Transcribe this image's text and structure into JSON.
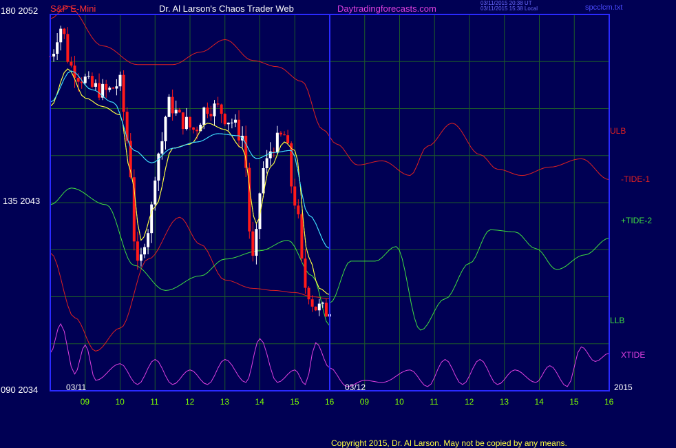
{
  "header": {
    "symbol": "S&P E-Mini",
    "title": "Dr. Al Larson's Chaos Trader Web",
    "site": "Daytradingforecasts.com",
    "timestamp_utc": "03/11/2015 20:38 UT",
    "timestamp_local": "03/11/2015 15:38 Local",
    "file": "spcclcm.txt"
  },
  "y_axis": {
    "top_label": "180  2052",
    "mid_label": "135  2043",
    "bottom_label": "090  2034"
  },
  "dates": {
    "left": "03/11",
    "right": "03/12",
    "year": "2015"
  },
  "footer": {
    "copyright": "Copyright 2015, Dr. Al Larson. May not be copied by any means."
  },
  "colors": {
    "background": "#000054",
    "frame": "#2a2aff",
    "grid": "#1c5a2a",
    "ulb": "#e02020",
    "llb": "#40e040",
    "tide1": "#e02020",
    "tide2": "#40e040",
    "xtide": "#e040e0",
    "candle_up": "#ffffff",
    "candle_down": "#ff1a1a",
    "ma_fast": "#ffff40",
    "ma_slow": "#40e0ff",
    "hour_label": "#7cfc00"
  },
  "chart_data": {
    "type": "line",
    "title": "S&P E-Mini",
    "x_tick_labels": [
      "09",
      "10",
      "11",
      "12",
      "13",
      "14",
      "15",
      "16",
      "09",
      "10",
      "11",
      "12",
      "13",
      "14",
      "15",
      "16"
    ],
    "y_axis_price": {
      "min": 2034,
      "max": 2052,
      "labels": [
        2034,
        2043,
        2052
      ]
    },
    "y_axis_cycle": {
      "min": 90,
      "max": 180,
      "labels": [
        90,
        135,
        180
      ]
    },
    "hours": {
      "start": 8.0,
      "sessions": 2,
      "session_end": 16.0
    },
    "series": [
      {
        "name": "ULB",
        "points": [
          [
            8.0,
            2051.8
          ],
          [
            8.5,
            2052.4
          ],
          [
            9.5,
            2050.5
          ],
          [
            10.5,
            2049.6
          ],
          [
            11.5,
            2049.6
          ],
          [
            12.3,
            2050.2
          ],
          [
            13.0,
            2050.8
          ],
          [
            13.8,
            2049.8
          ],
          [
            14.5,
            2049.5
          ],
          [
            15.2,
            2048.8
          ],
          [
            15.8,
            2046.5
          ],
          [
            16.2,
            2045.8
          ],
          [
            16.8,
            2044.8
          ],
          [
            17.5,
            2045.0
          ],
          [
            18.3,
            2044.3
          ],
          [
            18.8,
            2045.7
          ],
          [
            19.5,
            2046.8
          ],
          [
            20.3,
            2045.3
          ],
          [
            20.8,
            2044.6
          ],
          [
            21.5,
            2044.3
          ],
          [
            22.3,
            2044.7
          ],
          [
            23.2,
            2045.1
          ],
          [
            24.0,
            2044.1
          ]
        ]
      },
      {
        "name": "-TIDE-1",
        "points": [
          [
            8.0,
            2040.6
          ],
          [
            8.7,
            2037.5
          ],
          [
            9.3,
            2035.9
          ],
          [
            10.0,
            2037.0
          ],
          [
            10.8,
            2040.3
          ],
          [
            11.7,
            2042.3
          ],
          [
            12.3,
            2041.0
          ],
          [
            13.0,
            2039.3
          ],
          [
            13.8,
            2038.9
          ],
          [
            14.4,
            2038.8
          ],
          [
            15.0,
            2038.7
          ],
          [
            15.5,
            2038.5
          ],
          [
            16.0,
            2038.4
          ]
        ]
      },
      {
        "name": "+TIDE-2",
        "points": [
          [
            16.0,
            2038.2
          ],
          [
            16.6,
            2040.2
          ],
          [
            17.3,
            2040.2
          ],
          [
            17.9,
            2040.9
          ],
          [
            18.6,
            2036.9
          ],
          [
            19.3,
            2038.4
          ],
          [
            20.0,
            2040.1
          ],
          [
            20.6,
            2041.7
          ],
          [
            21.3,
            2041.6
          ],
          [
            21.9,
            2040.8
          ],
          [
            22.5,
            2039.8
          ],
          [
            23.3,
            2040.5
          ],
          [
            24.0,
            2041.3
          ]
        ]
      },
      {
        "name": "LLB",
        "points": [
          [
            8.0,
            2042.9
          ],
          [
            8.6,
            2043.7
          ],
          [
            9.6,
            2042.9
          ],
          [
            10.4,
            2040.0
          ],
          [
            11.3,
            2038.8
          ],
          [
            12.3,
            2039.5
          ],
          [
            13.0,
            2040.3
          ],
          [
            14.0,
            2040.7
          ],
          [
            14.8,
            2041.2
          ],
          [
            15.5,
            2039.5
          ],
          [
            16.0,
            2037.1
          ]
        ]
      },
      {
        "name": "XTIDE",
        "points": [
          [
            8.0,
            2035.8
          ],
          [
            8.3,
            2037.2
          ],
          [
            8.7,
            2034.8
          ],
          [
            9.0,
            2036.2
          ],
          [
            9.3,
            2034.5
          ],
          [
            10.0,
            2035.3
          ],
          [
            10.5,
            2034.3
          ],
          [
            11.0,
            2035.5
          ],
          [
            11.5,
            2034.3
          ],
          [
            12.0,
            2035.0
          ],
          [
            12.5,
            2034.3
          ],
          [
            13.0,
            2035.5
          ],
          [
            13.6,
            2034.4
          ],
          [
            14.0,
            2036.5
          ],
          [
            14.5,
            2034.4
          ],
          [
            15.0,
            2035.0
          ],
          [
            15.3,
            2034.3
          ],
          [
            15.6,
            2036.3
          ],
          [
            16.0,
            2035.1
          ],
          [
            16.5,
            2034.2
          ],
          [
            17.0,
            2034.5
          ],
          [
            17.5,
            2034.4
          ],
          [
            18.3,
            2035.0
          ],
          [
            18.8,
            2034.2
          ],
          [
            19.3,
            2035.5
          ],
          [
            19.8,
            2034.3
          ],
          [
            20.3,
            2035.5
          ],
          [
            20.8,
            2034.3
          ],
          [
            21.3,
            2035.0
          ],
          [
            21.9,
            2034.4
          ],
          [
            22.3,
            2035.2
          ],
          [
            22.8,
            2034.2
          ],
          [
            23.2,
            2036.1
          ],
          [
            23.6,
            2035.4
          ],
          [
            24.0,
            2035.8
          ]
        ]
      },
      {
        "name": "Price",
        "points": [
          [
            8.0,
            2050.0
          ],
          [
            8.3,
            2051.4
          ],
          [
            8.6,
            2049.5
          ],
          [
            8.9,
            2049.0
          ],
          [
            9.2,
            2048.5
          ],
          [
            9.6,
            2048.3
          ],
          [
            10.0,
            2048.7
          ],
          [
            10.2,
            2046.0
          ],
          [
            10.5,
            2039.8
          ],
          [
            10.8,
            2041.8
          ],
          [
            11.1,
            2045.4
          ],
          [
            11.4,
            2047.7
          ],
          [
            11.8,
            2046.9
          ],
          [
            12.1,
            2046.5
          ],
          [
            12.5,
            2047.6
          ],
          [
            12.8,
            2047.5
          ],
          [
            13.1,
            2047.0
          ],
          [
            13.5,
            2046.2
          ],
          [
            13.8,
            2040.2
          ],
          [
            14.1,
            2044.6
          ],
          [
            14.4,
            2045.8
          ],
          [
            14.7,
            2046.2
          ],
          [
            15.0,
            2043.1
          ],
          [
            15.3,
            2039.0
          ],
          [
            15.6,
            2038.0
          ],
          [
            15.9,
            2037.8
          ],
          [
            16.0,
            2038.0
          ]
        ]
      },
      {
        "name": "MA fast",
        "points": [
          [
            8.0,
            2047.6
          ],
          [
            8.5,
            2049.4
          ],
          [
            9.0,
            2048.0
          ],
          [
            9.5,
            2047.6
          ],
          [
            10.0,
            2047.2
          ],
          [
            10.3,
            2044.5
          ],
          [
            10.6,
            2041.2
          ],
          [
            11.0,
            2042.8
          ],
          [
            11.5,
            2045.6
          ],
          [
            12.0,
            2045.8
          ],
          [
            12.5,
            2046.8
          ],
          [
            13.0,
            2046.5
          ],
          [
            13.5,
            2045.6
          ],
          [
            13.9,
            2042.0
          ],
          [
            14.3,
            2044.7
          ],
          [
            14.7,
            2045.9
          ],
          [
            15.0,
            2045.5
          ],
          [
            15.4,
            2040.4
          ],
          [
            15.7,
            2038.9
          ],
          [
            16.0,
            2038.6
          ]
        ]
      },
      {
        "name": "MA slow",
        "points": [
          [
            8.0,
            2047.8
          ],
          [
            8.6,
            2049.3
          ],
          [
            9.2,
            2048.4
          ],
          [
            9.8,
            2047.8
          ],
          [
            10.4,
            2045.5
          ],
          [
            10.9,
            2044.9
          ],
          [
            11.5,
            2045.6
          ],
          [
            12.2,
            2045.9
          ],
          [
            12.8,
            2046.3
          ],
          [
            13.4,
            2046.2
          ],
          [
            13.9,
            2045.1
          ],
          [
            14.4,
            2045.4
          ],
          [
            14.9,
            2045.5
          ],
          [
            15.4,
            2042.4
          ],
          [
            16.0,
            2040.8
          ]
        ]
      }
    ],
    "legend_labels": [
      "ULB",
      "-TIDE-1",
      "+TIDE-2",
      "LLB",
      "XTIDE"
    ]
  }
}
